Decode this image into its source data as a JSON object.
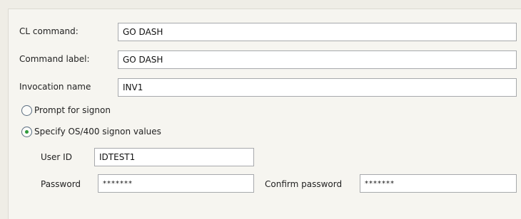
{
  "form": {
    "cl_command": {
      "label": "CL command:",
      "value": "GO DASH"
    },
    "command_label": {
      "label": "Command label:",
      "value": "GO DASH"
    },
    "invocation_name": {
      "label": "Invocation name",
      "value": "INV1"
    },
    "prompt_signon": {
      "label": "Prompt for signon",
      "selected": false
    },
    "specify_signon": {
      "label": "Specify OS/400 signon values",
      "selected": true
    },
    "user_id": {
      "label": "User ID",
      "value": "IDTEST1"
    },
    "password": {
      "label": "Password",
      "value": "*******"
    },
    "confirm_password": {
      "label": "Confirm password",
      "value": "*******"
    }
  },
  "colors": {
    "window_background": "#efede6",
    "panel_background": "#f6f5f0",
    "field_border": "#a7a9ac",
    "radio_selected_dot": "#2f9a3b"
  }
}
